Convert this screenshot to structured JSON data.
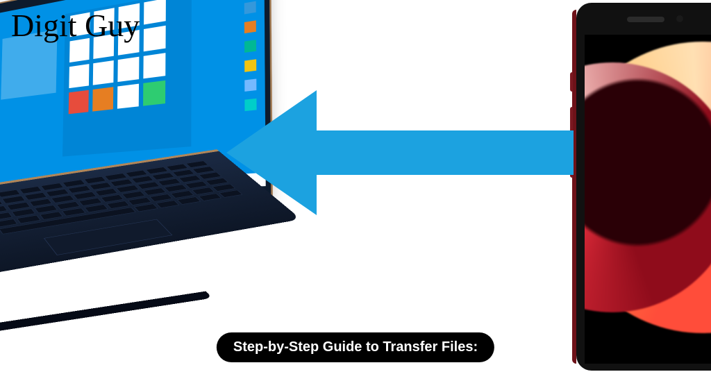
{
  "watermark": "Digit Guy",
  "caption": "Step-by-Step Guide to Transfer Files:",
  "arrow": {
    "direction": "left",
    "color": "#1ca2e0"
  },
  "laptop": {
    "os_hint": "Windows 10 Start Menu",
    "accent": "#0091e6",
    "tiles": [
      "",
      "",
      "",
      "",
      "",
      "",
      "",
      "",
      "",
      "",
      "",
      "",
      "",
      "",
      "",
      ""
    ]
  },
  "phone": {
    "model_hint": "iPhone",
    "frame_color": "#6e1219"
  }
}
